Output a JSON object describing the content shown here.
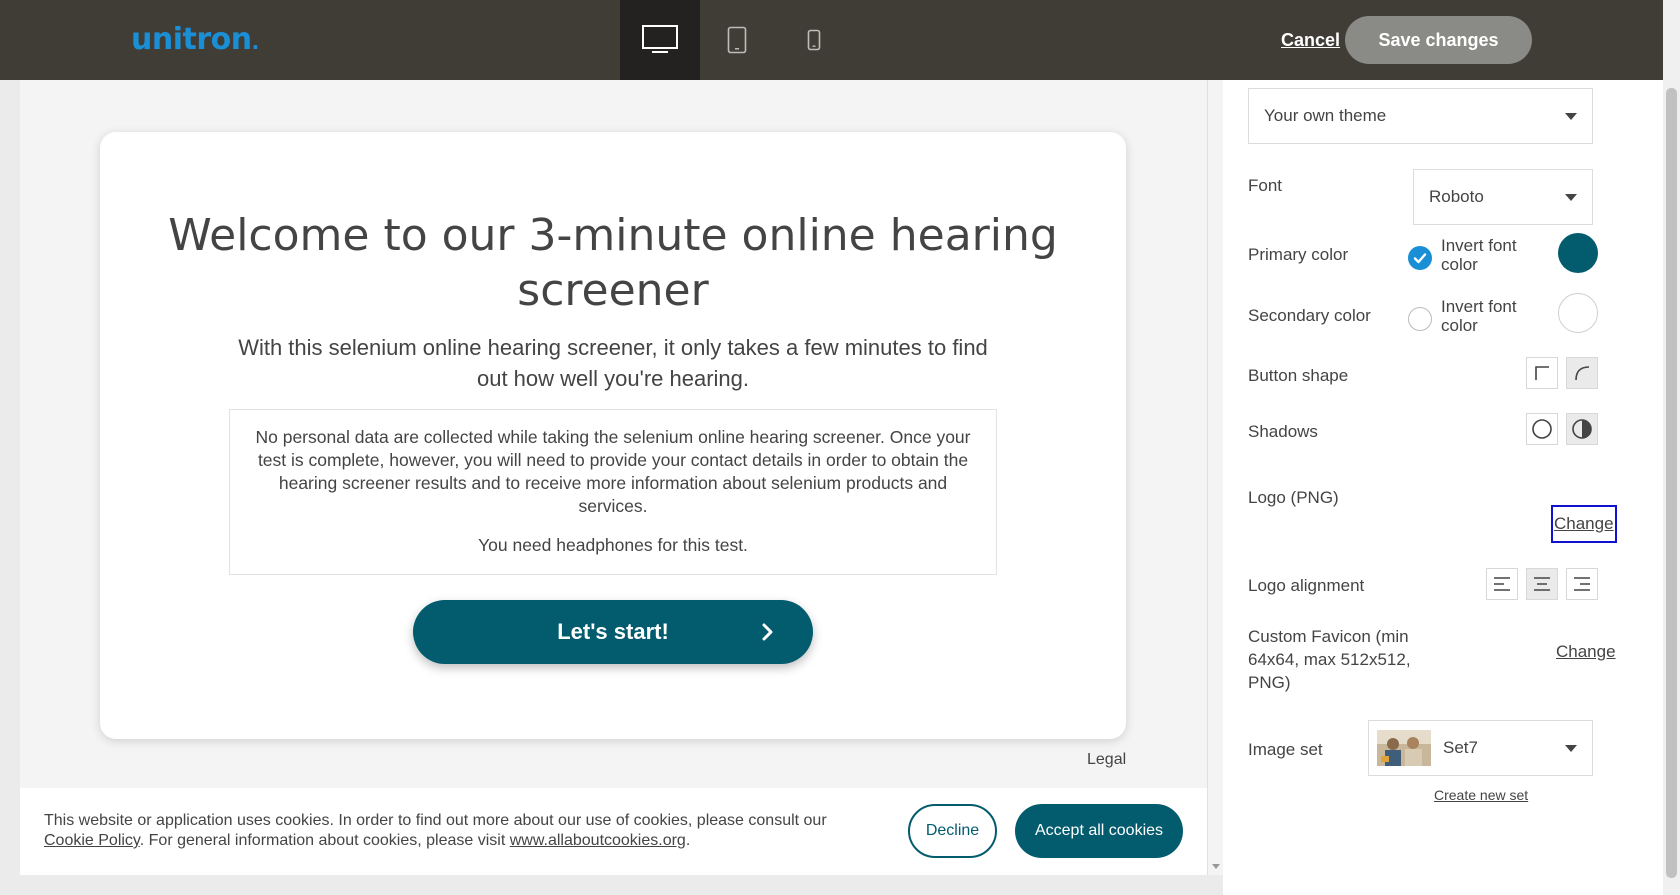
{
  "header": {
    "brand": "unitron",
    "device_icons": [
      "desktop-icon",
      "tablet-icon",
      "mobile-icon"
    ],
    "cancel_label": "Cancel",
    "save_label": "Save changes"
  },
  "preview": {
    "title": "Welcome to our 3-minute online hearing screener",
    "subtitle": "With this selenium online hearing screener, it only takes a few minutes to find out how well you're hearing.",
    "info_paragraph": "No personal data are collected while taking the selenium online hearing screener. Once your test is complete, however, you will need to provide your contact details in order to obtain the hearing screener results and to receive more information about selenium products and services.",
    "info_note": "You need headphones for this test.",
    "start_button": "Let's start!",
    "legal": "Legal"
  },
  "cookie_bar": {
    "text_1": "This website or application uses cookies. In order to find out more about our use of cookies, please consult our",
    "cookie_policy_link": "Cookie Policy",
    "text_2": ". For general information about cookies, please visit",
    "allaboutcookies_link": "www.allaboutcookies.org",
    "text_3": ".",
    "decline": "Decline",
    "accept": "Accept all cookies"
  },
  "panel": {
    "theme_value": "Your own theme",
    "font_label": "Font",
    "font_value": "Roboto",
    "primary_label": "Primary color",
    "primary_invert_label": "Invert font color",
    "primary_invert_checked": true,
    "primary_color": "#035b6e",
    "secondary_label": "Secondary color",
    "secondary_invert_label": "Invert font color",
    "secondary_invert_checked": false,
    "secondary_color": "#ffffff",
    "button_shape_label": "Button shape",
    "shadows_label": "Shadows",
    "logo_label": "Logo (PNG)",
    "logo_change": "Change",
    "logo_alignment_label": "Logo alignment",
    "favicon_label": "Custom Favicon (min 64x64, max 512x512, PNG)",
    "favicon_change": "Change",
    "image_set_label": "Image set",
    "image_set_value": "Set7",
    "create_new_set": "Create new set"
  }
}
